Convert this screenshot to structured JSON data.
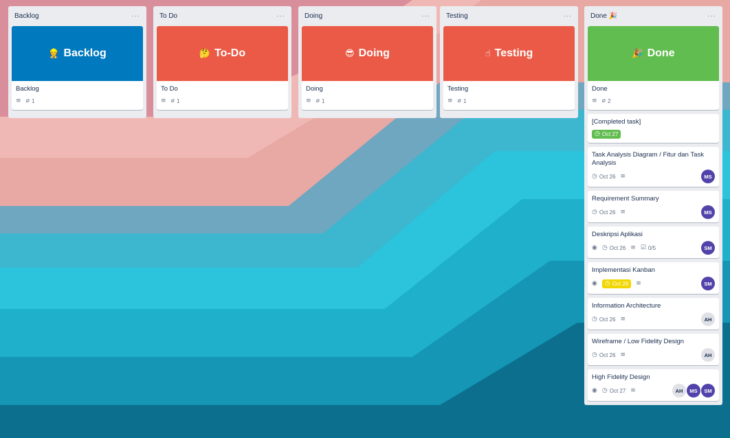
{
  "colors": {
    "backlog_cover": "#0079bf",
    "red_cover": "#eb5a46",
    "green_cover": "#61bd4f",
    "due_green": "#61bd4f",
    "due_yellow": "#f2d600",
    "avatar_purple": "#5243aa",
    "avatar_gray": "#dfe1e6",
    "list_bg": "#ebecf0"
  },
  "lists": [
    {
      "title": "Backlog",
      "menu": "···",
      "cover": {
        "emoji": "👷",
        "text": "Backlog",
        "color": "#0079bf"
      },
      "card_title": "Backlog",
      "attachments": "1"
    },
    {
      "title": "To Do",
      "menu": "···",
      "cover": {
        "emoji": "🤔",
        "text": "To-Do",
        "color": "#eb5a46"
      },
      "card_title": "To Do",
      "attachments": "1"
    },
    {
      "title": "Doing",
      "menu": "···",
      "cover": {
        "emoji": "😎",
        "text": "Doing",
        "color": "#eb5a46"
      },
      "card_title": "Doing",
      "attachments": "1"
    },
    {
      "title": "Testing",
      "menu": "···",
      "cover": {
        "emoji": "☝",
        "text": "Testing",
        "color": "#eb5a46"
      },
      "card_title": "Testing",
      "attachments": "1"
    },
    {
      "title": "Done 🎉",
      "menu": "···",
      "cover": {
        "emoji": "🎉",
        "text": "Done",
        "color": "#61bd4f"
      },
      "card_title": "Done",
      "attachments": "2"
    }
  ],
  "done_cards": [
    {
      "title": "[Completed task]",
      "due": "Oct 27",
      "due_style": "green"
    },
    {
      "title": "Task Analysis Diagram / Fitur dan Task Analysis",
      "due": "Oct 26",
      "members": [
        "MS"
      ]
    },
    {
      "title": "Requirement Summary",
      "due": "Oct 26",
      "members": [
        "MS"
      ]
    },
    {
      "title": "Deskripsi Aplikasi",
      "due": "Oct 26",
      "watch": true,
      "checklist": "0/5",
      "members": [
        "SM"
      ]
    },
    {
      "title": "Implementasi Kanban",
      "due": "Oct 26",
      "due_style": "yellow",
      "watch": true,
      "members": [
        "SM"
      ]
    },
    {
      "title": "Information Architecture",
      "due": "Oct 26",
      "members": [
        "AH"
      ]
    },
    {
      "title": "Wireframe / Low Fidelity Design",
      "due": "Oct 26",
      "members": [
        "AH"
      ]
    },
    {
      "title": "High Fidelity Design",
      "due": "Oct 27",
      "watch": true,
      "members": [
        "AH",
        "MS",
        "SM"
      ]
    }
  ],
  "icons": {
    "description": "description-icon",
    "attachment": "paperclip-icon",
    "clock": "clock-icon",
    "watch": "eye-icon",
    "checklist": "checklist-icon"
  }
}
